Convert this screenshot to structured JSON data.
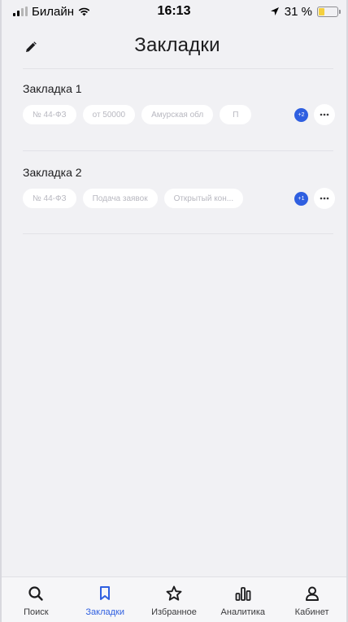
{
  "status_bar": {
    "carrier": "Билайн",
    "time": "16:13",
    "battery_text": "31 %",
    "battery_level": 0.31
  },
  "header": {
    "title": "Закладки",
    "edit_icon": "pencil-icon"
  },
  "bookmarks": [
    {
      "title": "Закладка 1",
      "chips": [
        "№ 44-ФЗ",
        "от 50000",
        "Амурская обл",
        "П"
      ],
      "extra_count": "+2"
    },
    {
      "title": "Закладка 2",
      "chips": [
        "№ 44-ФЗ",
        "Подача заявок",
        "Открытый кон..."
      ],
      "extra_count": "+1"
    }
  ],
  "tab_bar": {
    "tabs": [
      {
        "label": "Поиск",
        "icon": "search-icon",
        "active": false
      },
      {
        "label": "Закладки",
        "icon": "bookmark-icon",
        "active": true
      },
      {
        "label": "Избранное",
        "icon": "star-icon",
        "active": false
      },
      {
        "label": "Аналитика",
        "icon": "bar-chart-icon",
        "active": false
      },
      {
        "label": "Кабинет",
        "icon": "person-icon",
        "active": false
      }
    ]
  },
  "colors": {
    "accent": "#2f5fe0",
    "background": "#f1f1f4",
    "chip_background": "#ffffff",
    "chip_text": "#b8b8c0",
    "battery": "#f4d03f"
  }
}
